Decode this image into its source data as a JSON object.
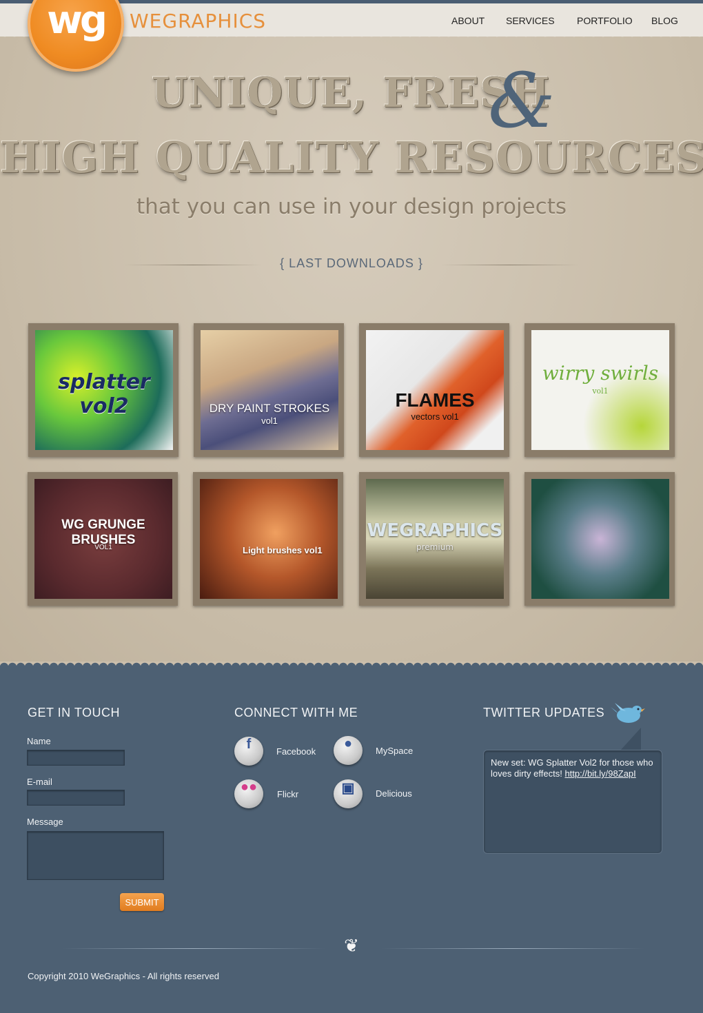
{
  "header": {
    "brand": "WEGRAPHICS",
    "logo_mark": "wg",
    "nav": [
      "ABOUT",
      "SERVICES",
      "PORTFOLIO",
      "BLOG"
    ]
  },
  "hero": {
    "line1": "UNIQUE, FRESH",
    "amp": "&",
    "line2": "HIGH QUALITY RESOURCES",
    "subtitle": "that you can use in your design projects"
  },
  "downloads": {
    "title": "{  LAST DOWNLOADS  }",
    "items": [
      {
        "label": "splatter vol2"
      },
      {
        "label": "DRY PAINT STROKES",
        "sub": "vol1"
      },
      {
        "label": "FLAMES",
        "sub": "vectors vol1"
      },
      {
        "label": "wirry swirls",
        "sub": "vol1"
      },
      {
        "label": "WG GRUNGE BRUSHES",
        "sub": "VOL1"
      },
      {
        "label": "Light brushes vol1"
      },
      {
        "label": "WEGRAPHICS",
        "sub": "premium"
      },
      {
        "label": ""
      }
    ]
  },
  "contact": {
    "title": "GET IN TOUCH",
    "name_label": "Name",
    "email_label": "E-mail",
    "message_label": "Message",
    "submit_label": "SUBMIT"
  },
  "connect": {
    "title": "CONNECT WITH ME",
    "networks": [
      {
        "label": "Facebook",
        "icon": "facebook-icon"
      },
      {
        "label": "MySpace",
        "icon": "myspace-icon"
      },
      {
        "label": "Flickr",
        "icon": "flickr-icon"
      },
      {
        "label": "Delicious",
        "icon": "delicious-icon"
      }
    ]
  },
  "twitter": {
    "title": "TWITTER UPDATES",
    "tweet_text": "New set: WG Splatter Vol2 for those who loves dirty effects!",
    "tweet_link": "http://bit.ly/98ZapI"
  },
  "footer": {
    "copyright": "Copyright 2010 WeGraphics - All rights reserved"
  },
  "colors": {
    "accent_orange": "#ef8b22",
    "footer_blue": "#4d6073",
    "page_beige": "#cbbfac"
  }
}
